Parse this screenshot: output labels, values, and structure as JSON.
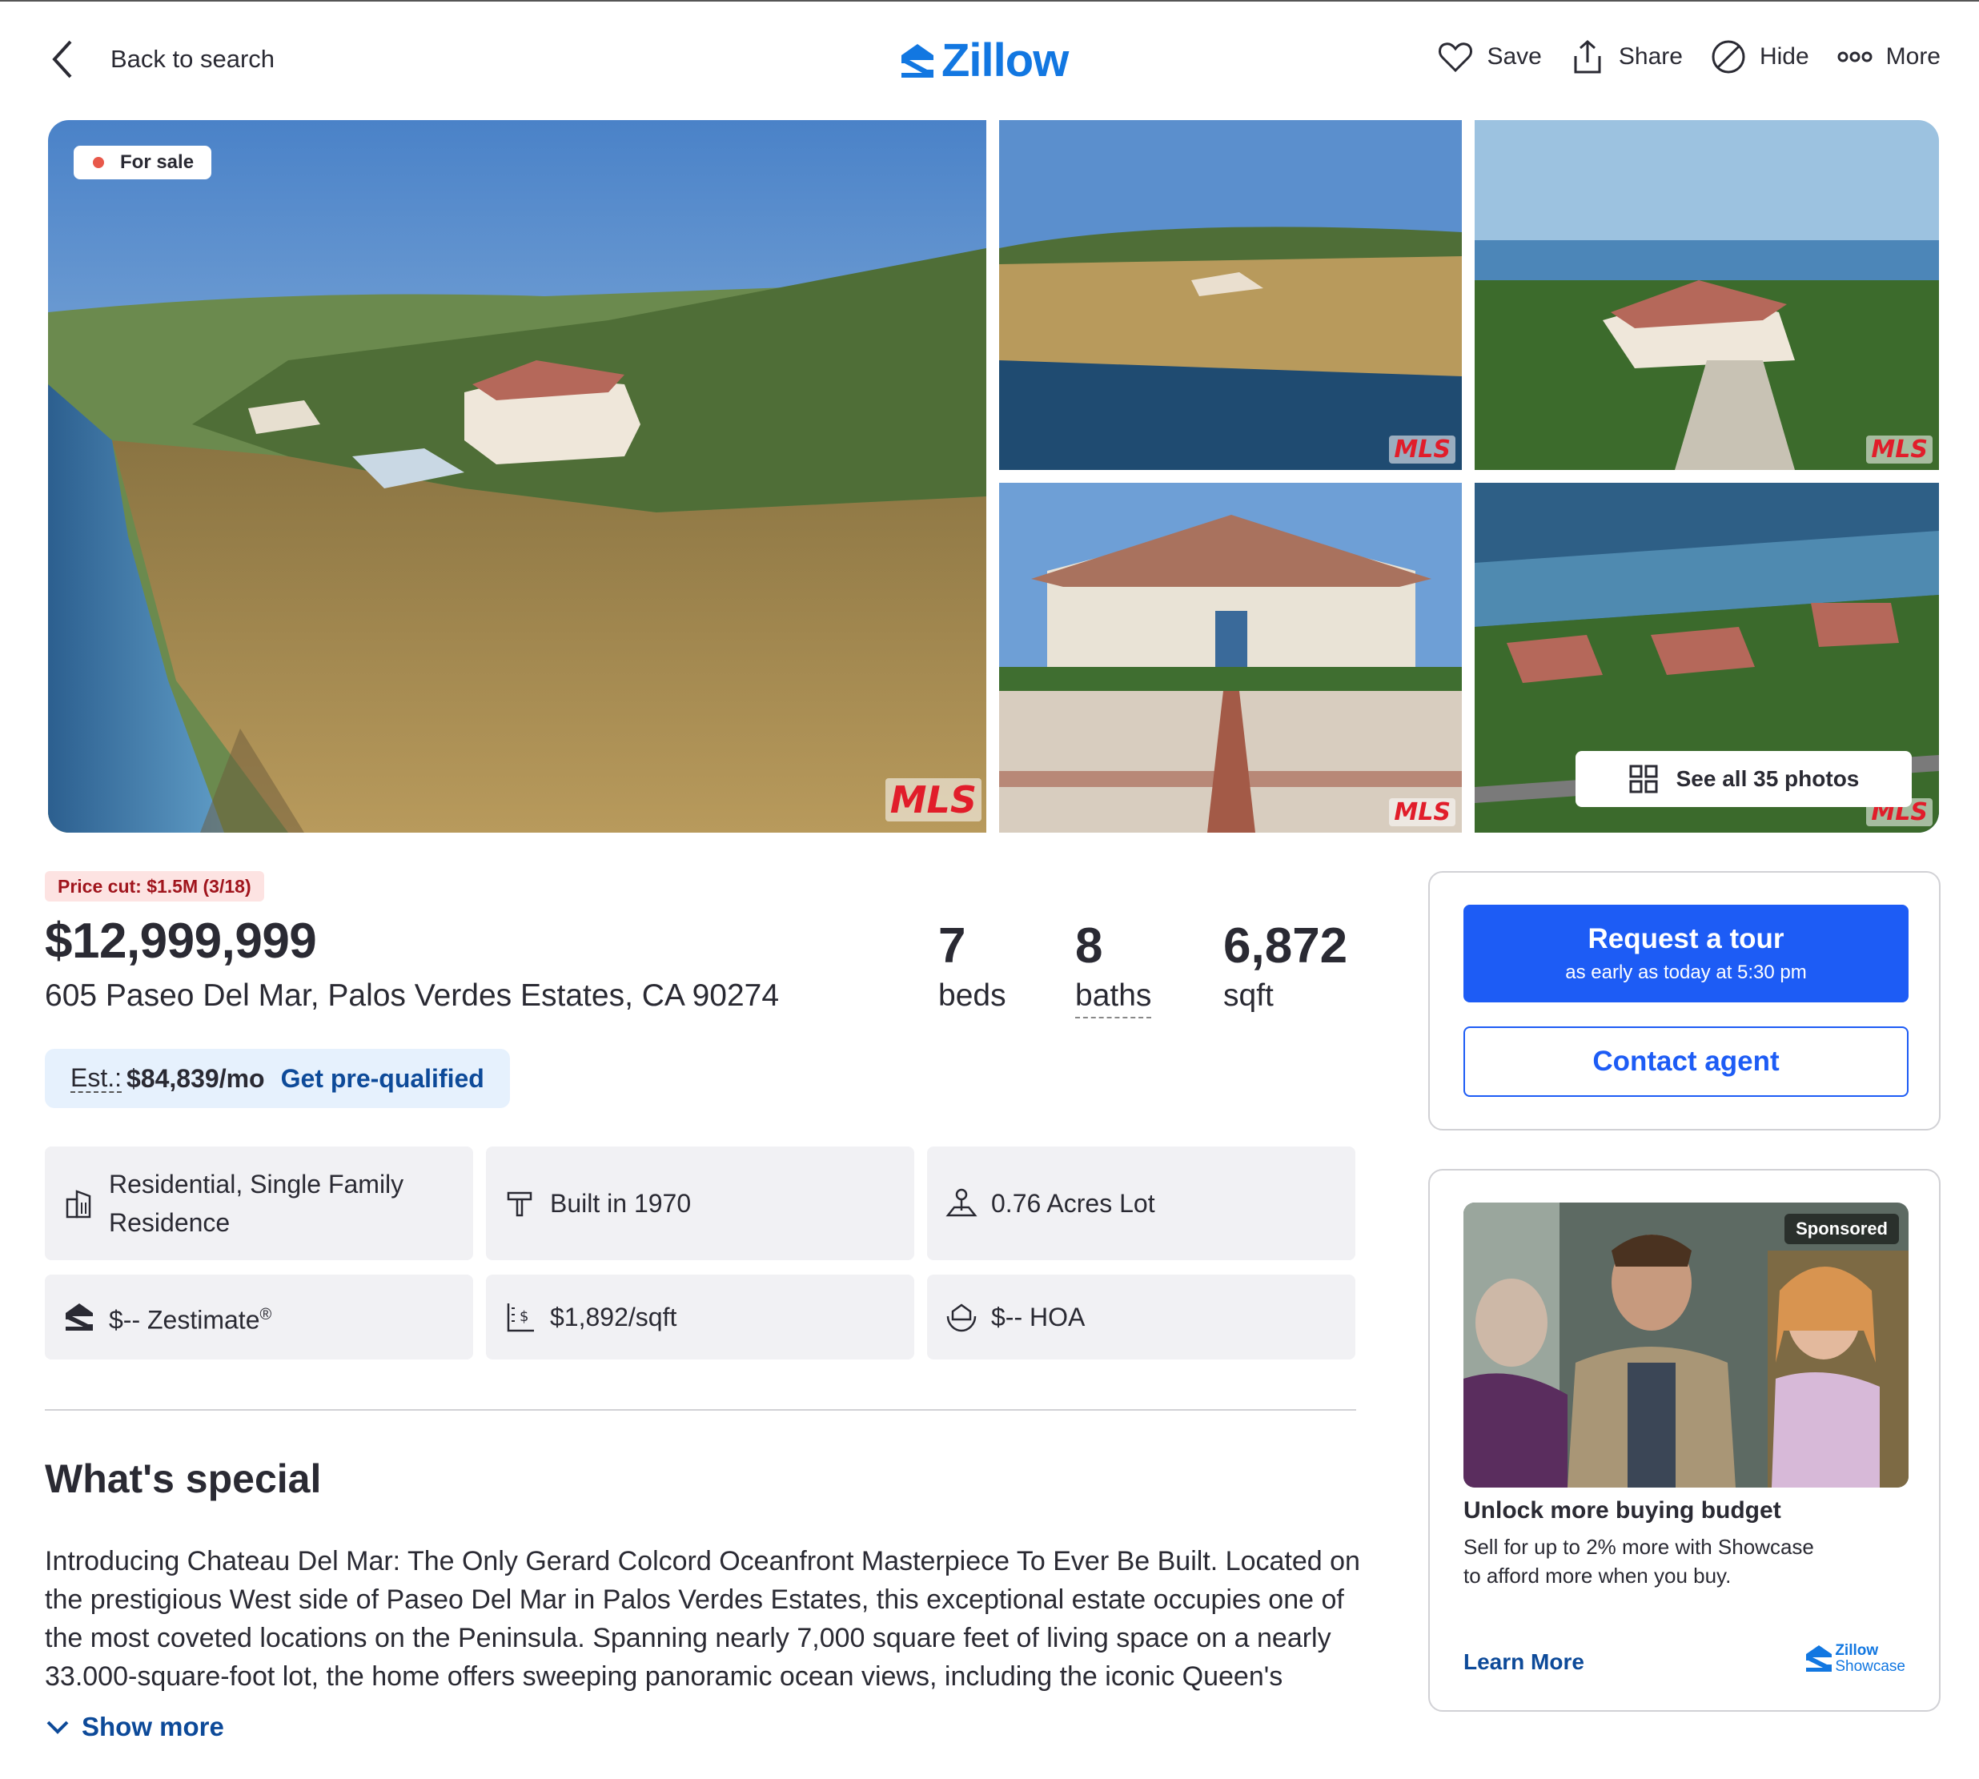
{
  "header": {
    "back_label": "Back to search",
    "brand": "Zillow",
    "actions": [
      {
        "label": "Save",
        "icon": "heart-icon"
      },
      {
        "label": "Share",
        "icon": "share-icon"
      },
      {
        "label": "Hide",
        "icon": "hide-icon"
      },
      {
        "label": "More",
        "icon": "more-dots-icon"
      }
    ]
  },
  "gallery": {
    "status_badge": "For sale",
    "mls_mark": "MLS",
    "see_all_label": "See all 35 photos"
  },
  "listing": {
    "price_cut": "Price cut: $1.5M (3/18)",
    "price": "$12,999,999",
    "address": "605 Paseo Del Mar, Palos Verdes Estates, CA 90274",
    "beds": {
      "value": "7",
      "unit": "beds"
    },
    "baths": {
      "value": "8",
      "unit": "baths"
    },
    "sqft": {
      "value": "6,872",
      "unit": "sqft"
    },
    "estimate": {
      "label": "Est.:",
      "value": "$84,839/mo",
      "link": "Get pre-qualified"
    }
  },
  "facts": [
    {
      "text": "Residential, Single Family Residence",
      "icon": "building-icon"
    },
    {
      "text": "Built in 1970",
      "icon": "hammer-icon"
    },
    {
      "text": "0.76 Acres Lot",
      "icon": "lot-icon"
    },
    {
      "text": "$-- Zestimate",
      "sup": "®",
      "icon": "zestimate-icon"
    },
    {
      "text": "$1,892/sqft",
      "icon": "price-per-sqft-icon"
    },
    {
      "text": "$-- HOA",
      "icon": "hoa-icon"
    }
  ],
  "whats_special": {
    "heading": "What's special",
    "description": "Introducing Chateau Del Mar: The Only Gerard Colcord Oceanfront Masterpiece To Ever Be Built. Located on the prestigious West side of Paseo Del Mar in Palos Verdes Estates, this exceptional estate occupies one of the most coveted locations on the Peninsula. Spanning nearly 7,000 square feet of living space on a nearly 33.000-square-foot lot, the home offers sweeping panoramic ocean views, including the iconic Queen's",
    "show_more": "Show more"
  },
  "tour_card": {
    "request_title": "Request a tour",
    "request_sub": "as early as today at 5:30 pm",
    "contact_label": "Contact agent"
  },
  "ad": {
    "sponsored": "Sponsored",
    "title": "Unlock more buying budget",
    "text": "Sell for up to 2% more with Showcase to afford more when you buy.",
    "learn_more": "Learn More",
    "logo_line1": "Zillow",
    "logo_line2": "Showcase"
  },
  "colors": {
    "brand_blue": "#1277e1",
    "button_blue": "#1d5cf5",
    "link_blue": "#0d4a99",
    "price_cut_bg": "#fde3e2",
    "price_cut_text": "#a0151d",
    "status_dot": "#e8584a"
  }
}
